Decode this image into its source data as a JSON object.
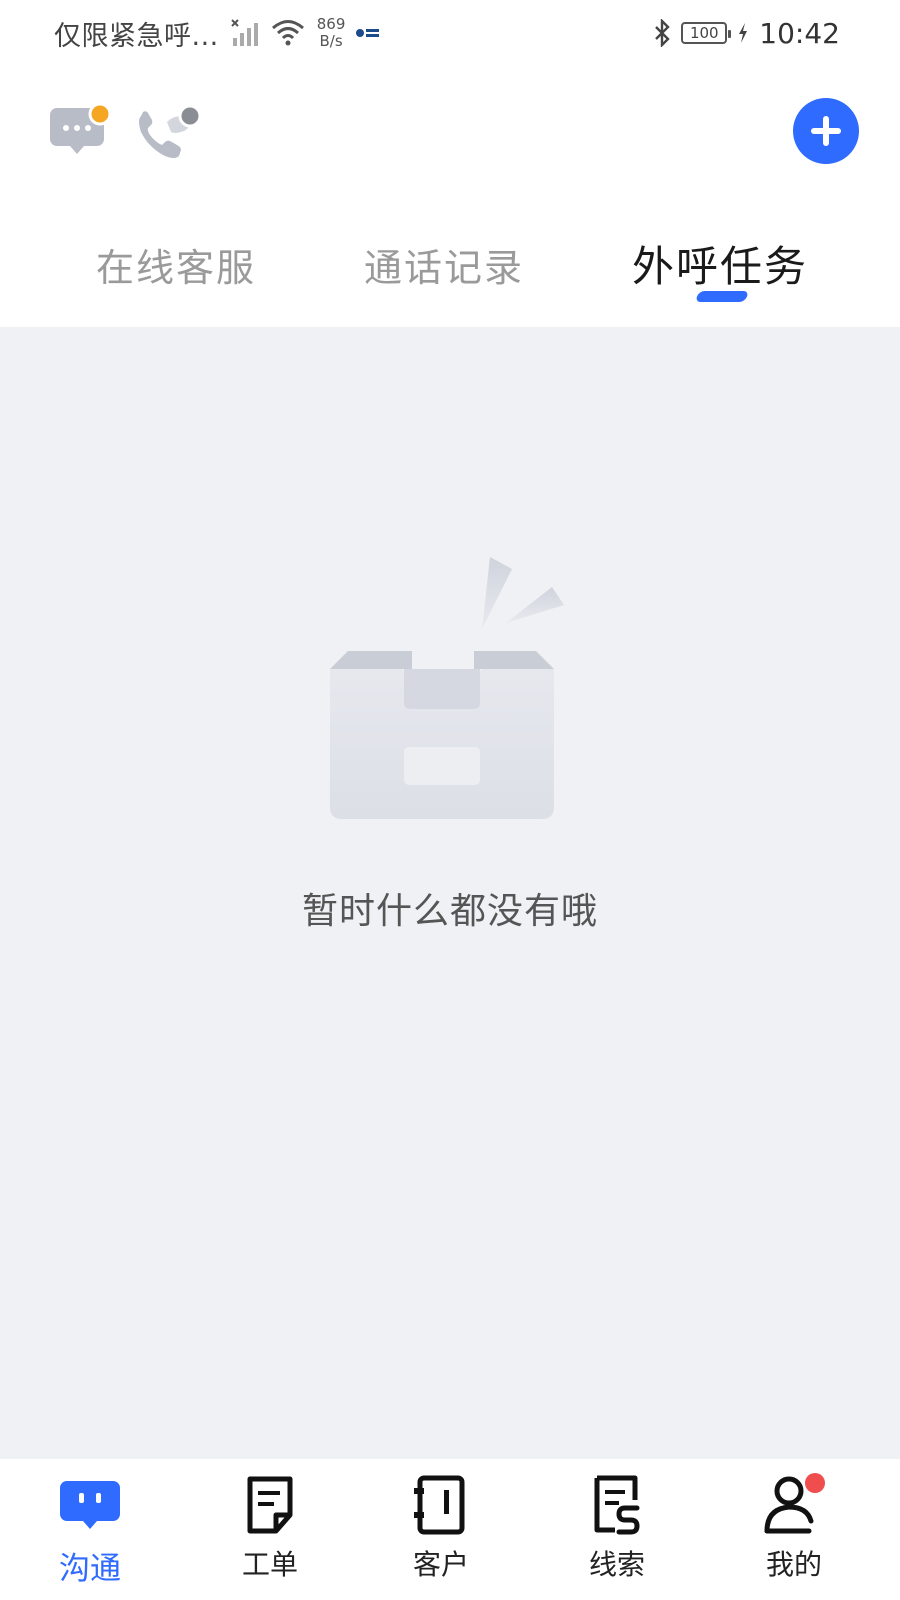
{
  "status_bar": {
    "carrier": "仅限紧急呼...",
    "speed_value": "869",
    "speed_unit": "B/s",
    "battery": "100",
    "time": "10:42"
  },
  "header": {
    "icons": [
      "message-icon",
      "phone-icon"
    ],
    "add_button": "plus-icon"
  },
  "tabs": [
    {
      "label": "在线客服",
      "active": false
    },
    {
      "label": "通话记录",
      "active": false
    },
    {
      "label": "外呼任务",
      "active": true
    }
  ],
  "empty_state": {
    "text": "暂时什么都没有哦"
  },
  "bottom_nav": [
    {
      "label": "沟通",
      "icon": "chat-icon",
      "active": true
    },
    {
      "label": "工单",
      "icon": "work-order-icon",
      "active": false
    },
    {
      "label": "客户",
      "icon": "customer-icon",
      "active": false
    },
    {
      "label": "线索",
      "icon": "lead-icon",
      "active": false
    },
    {
      "label": "我的",
      "icon": "profile-icon",
      "active": false
    }
  ],
  "colors": {
    "accent": "#2f6bff",
    "badge_orange": "#f5a623",
    "badge_red": "#f04e4e",
    "content_bg": "#f0f1f4"
  }
}
